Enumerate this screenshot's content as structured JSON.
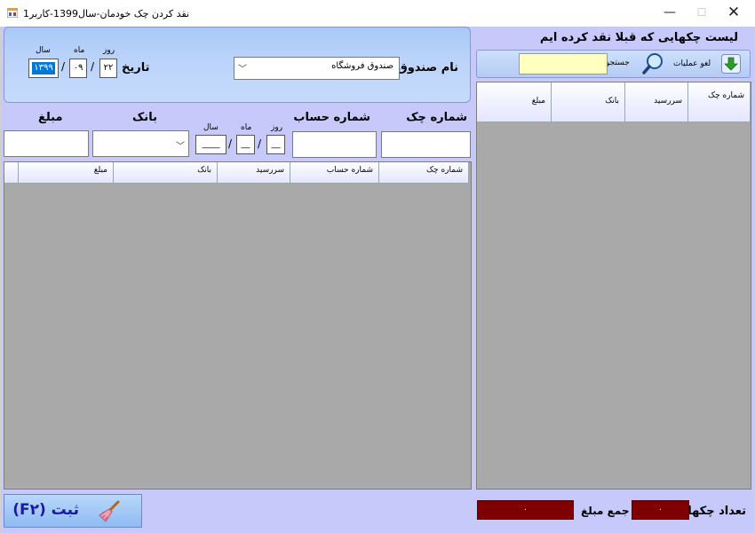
{
  "window": {
    "title": "نقد کردن چک خودمان-سال1399-کاربر1",
    "minimize": "—",
    "maximize": "☐",
    "close": "✕"
  },
  "header": {
    "fund_label": "نام صندوق",
    "fund_value": "صندوق فروشگاه",
    "date_label": "تاریخ",
    "day_caption": "روز",
    "month_caption": "ماه",
    "year_caption": "سال",
    "day": "۲۲",
    "month": "۰۹",
    "year": "۱۳۹۹"
  },
  "entry": {
    "check_no_label": "شماره چک",
    "account_no_label": "شماره حساب",
    "bank_label": "بانک",
    "amount_label": "مبلغ",
    "day_caption": "روز",
    "month_caption": "ماه",
    "year_caption": "سال",
    "day_value": "__",
    "month_value": "__",
    "year_value": "____",
    "slash": "/"
  },
  "main_grid": {
    "columns": [
      "شماره چک",
      "شماره حساب",
      "سررسید",
      "بانک",
      "مبلغ"
    ]
  },
  "side": {
    "title": "لیست چکهایی که قبلا نقد کرده ایم",
    "cancel_label": "لغو عملیات",
    "search_label": "جستجو",
    "search_value": "",
    "columns": [
      "شماره چک",
      "سررسید",
      "بانک",
      "مبلغ"
    ]
  },
  "footer": {
    "count_label": "تعداد چکها",
    "count_value": "۰",
    "sum_label": "جمع مبلغ",
    "sum_value": "۰",
    "save_label": "ثبت (F۲)"
  },
  "colors": {
    "client_bg": "#c7c9fb",
    "grid_bg": "#a9a9a9",
    "total_box": "#800000",
    "save_text": "#1a1aa6",
    "search_field": "#ffffc0"
  }
}
